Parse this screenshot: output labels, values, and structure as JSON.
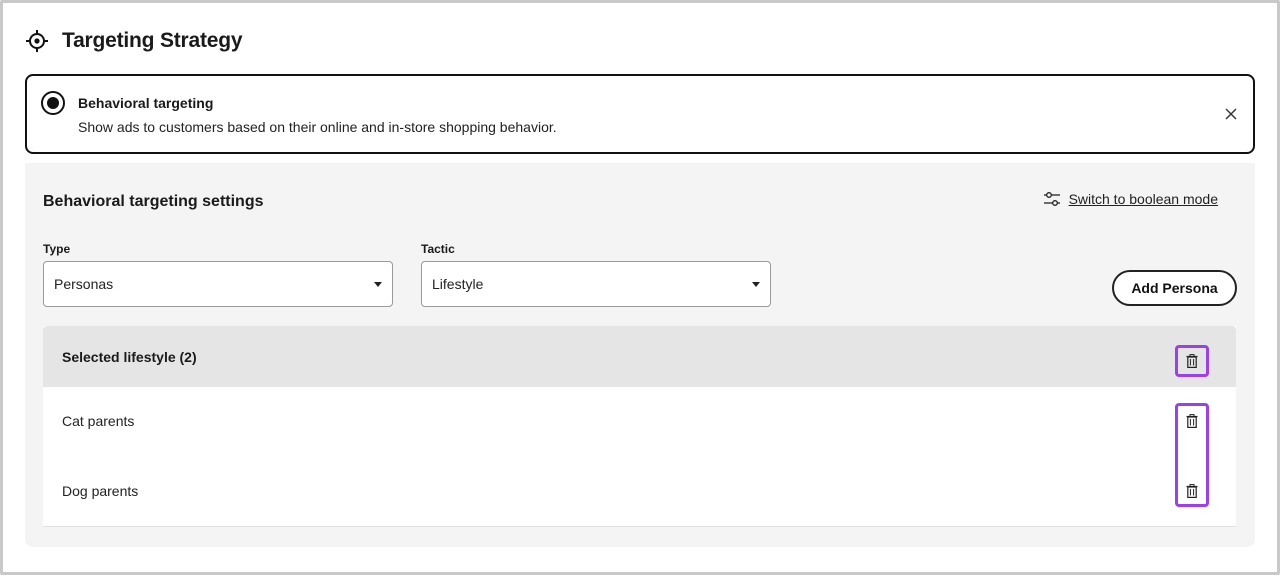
{
  "header": {
    "title": "Targeting Strategy",
    "icon": "crosshair-icon"
  },
  "strategy": {
    "title": "Behavioral targeting",
    "description": "Show ads to customers based on their online and in-store shopping behavior.",
    "selected": true
  },
  "settings": {
    "title": "Behavioral targeting settings",
    "switch_link": "Switch to boolean mode",
    "type": {
      "label": "Type",
      "value": "Personas"
    },
    "tactic": {
      "label": "Tactic",
      "value": "Lifestyle"
    },
    "add_button": "Add Persona"
  },
  "selected_list": {
    "title": "Selected lifestyle (2)",
    "items": [
      {
        "label": "Cat parents"
      },
      {
        "label": "Dog parents"
      }
    ]
  },
  "colors": {
    "highlight": "#9b40f0",
    "panel_bg": "#f4f4f4",
    "list_header_bg": "#e5e5e5",
    "border_dark": "#111111"
  }
}
